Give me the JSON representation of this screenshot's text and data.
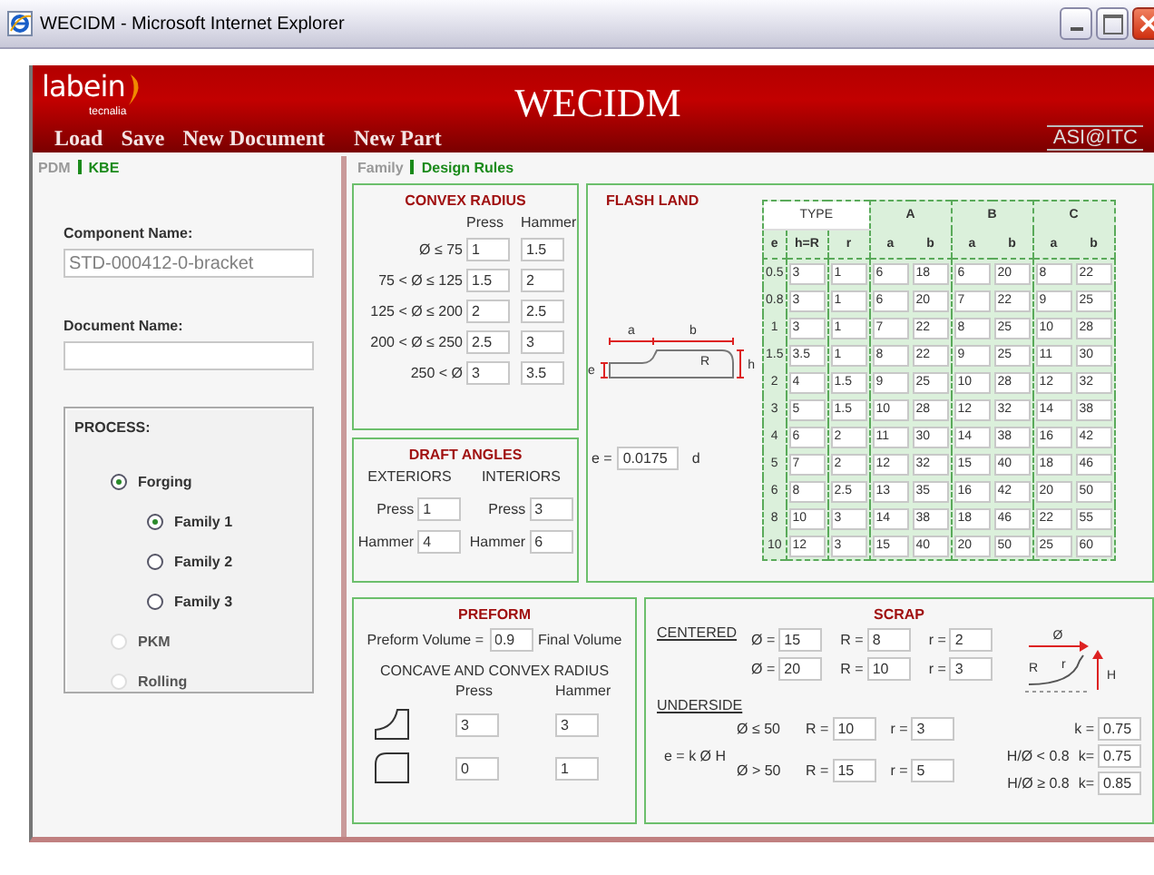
{
  "window": {
    "title": "WECIDM - Microsoft Internet Explorer"
  },
  "header": {
    "logo": "labein",
    "logo_sub": "tecnalia",
    "title": "WECIDM",
    "partner_logo": "ASI@ITC"
  },
  "menu": [
    "Load",
    "Save",
    "New Document",
    "New Part"
  ],
  "left_tabs": [
    {
      "label": "PDM",
      "selected": false
    },
    {
      "label": "KBE",
      "selected": true
    }
  ],
  "component": {
    "label": "Component Name:",
    "value": "STD-000412-0-bracket",
    "disabled": true
  },
  "document": {
    "label": "Document Name:"
  },
  "process": {
    "title": "PROCESS:",
    "options": [
      {
        "label": "Forging",
        "selected": true,
        "disabled": false,
        "children": [
          {
            "label": "Family 1",
            "selected": true,
            "disabled": false
          },
          {
            "label": "Family 2",
            "selected": false,
            "disabled": false
          },
          {
            "label": "Family 3",
            "selected": false,
            "disabled": false
          }
        ]
      },
      {
        "label": "PKM",
        "selected": false,
        "disabled": true
      },
      {
        "label": "Rolling",
        "selected": false,
        "disabled": true
      }
    ]
  },
  "right_tabs": [
    {
      "label": "Family",
      "selected": false
    },
    {
      "label": "Design Rules",
      "selected": true
    }
  ],
  "convex_radius": {
    "title": "CONVEX RADIUS",
    "columns": [
      "Press",
      "Hammer"
    ],
    "rows": [
      {
        "range": "Ø ≤ 75",
        "press": "1",
        "hammer": "1.5"
      },
      {
        "range": "75 < Ø ≤ 125",
        "press": "1.5",
        "hammer": "2"
      },
      {
        "range": "125 < Ø ≤ 200",
        "press": "2",
        "hammer": "2.5"
      },
      {
        "range": "200 < Ø ≤ 250",
        "press": "2.5",
        "hammer": "3"
      },
      {
        "range": "250 < Ø",
        "press": "3",
        "hammer": "3.5"
      }
    ]
  },
  "draft_angles": {
    "title": "DRAFT ANGLES",
    "groups": [
      {
        "heading": "EXTERIORS",
        "fields": [
          {
            "label": "Press",
            "value": "1"
          },
          {
            "label": "Hammer",
            "value": "4"
          }
        ]
      },
      {
        "heading": "INTERIORS",
        "fields": [
          {
            "label": "Press",
            "value": "3"
          },
          {
            "label": "Hammer",
            "value": "6"
          }
        ]
      }
    ]
  },
  "flash_land": {
    "title": "FLASH LAND",
    "diagram_labels": [
      "a",
      "b",
      "R",
      "h",
      "e"
    ],
    "formula": {
      "label": "e =",
      "value": "0.0175",
      "unit": "d"
    },
    "table": {
      "type_header": "TYPE",
      "groups": [
        "A",
        "B",
        "C"
      ],
      "columns": [
        "e",
        "h=R",
        "r",
        "a",
        "b",
        "a",
        "b",
        "a",
        "b"
      ],
      "rows": [
        [
          "0.5",
          "3",
          "1",
          "6",
          "18",
          "6",
          "20",
          "8",
          "22"
        ],
        [
          "0.8",
          "3",
          "1",
          "6",
          "20",
          "7",
          "22",
          "9",
          "25"
        ],
        [
          "1",
          "3",
          "1",
          "7",
          "22",
          "8",
          "25",
          "10",
          "28"
        ],
        [
          "1.5",
          "3.5",
          "1",
          "8",
          "22",
          "9",
          "25",
          "11",
          "30"
        ],
        [
          "2",
          "4",
          "1.5",
          "9",
          "25",
          "10",
          "28",
          "12",
          "32"
        ],
        [
          "3",
          "5",
          "1.5",
          "10",
          "28",
          "12",
          "32",
          "14",
          "38"
        ],
        [
          "4",
          "6",
          "2",
          "11",
          "30",
          "14",
          "38",
          "16",
          "42"
        ],
        [
          "5",
          "7",
          "2",
          "12",
          "32",
          "15",
          "40",
          "18",
          "46"
        ],
        [
          "6",
          "8",
          "2.5",
          "13",
          "35",
          "16",
          "42",
          "20",
          "50"
        ],
        [
          "8",
          "10",
          "3",
          "14",
          "38",
          "18",
          "46",
          "22",
          "55"
        ],
        [
          "10",
          "12",
          "3",
          "15",
          "40",
          "20",
          "50",
          "25",
          "60"
        ]
      ]
    }
  },
  "preform": {
    "title": "PREFORM",
    "volume": {
      "label": "Preform Volume =",
      "value": "0.9",
      "unit": "Final Volume"
    },
    "subtitle": "CONCAVE AND CONVEX RADIUS",
    "columns": [
      "Press",
      "Hammer"
    ],
    "rows": [
      {
        "kind": "concave",
        "press": "3",
        "hammer": "3"
      },
      {
        "kind": "convex",
        "press": "0",
        "hammer": "1"
      }
    ]
  },
  "scrap": {
    "title": "SCRAP",
    "centered": {
      "label": "CENTERED",
      "rows": [
        [
          {
            "label": "Ø =",
            "value": "15"
          },
          {
            "label": "R =",
            "value": "8"
          },
          {
            "label": "r =",
            "value": "2"
          }
        ],
        [
          {
            "label": "Ø =",
            "value": "20"
          },
          {
            "label": "R =",
            "value": "10"
          },
          {
            "label": "r =",
            "value": "3"
          }
        ]
      ]
    },
    "diagram_labels": [
      "Ø",
      "R",
      "r",
      "H"
    ],
    "underside": {
      "label": "UNDERSIDE",
      "formula": "e = k Ø H",
      "rows": [
        {
          "condition": "Ø ≤ 50",
          "fields": [
            {
              "label": "R =",
              "value": "10"
            },
            {
              "label": "r =",
              "value": "3"
            }
          ],
          "k": [
            {
              "label": "k =",
              "value": "0.75"
            }
          ]
        },
        {
          "condition": "Ø > 50",
          "fields": [
            {
              "label": "R =",
              "value": "15"
            },
            {
              "label": "r =",
              "value": "5"
            }
          ],
          "k": [
            {
              "condition": "H/Ø < 0.8",
              "label": "k=",
              "value": "0.75"
            },
            {
              "condition": "H/Ø ≥ 0.8",
              "label": "k=",
              "value": "0.85"
            }
          ]
        }
      ]
    }
  }
}
